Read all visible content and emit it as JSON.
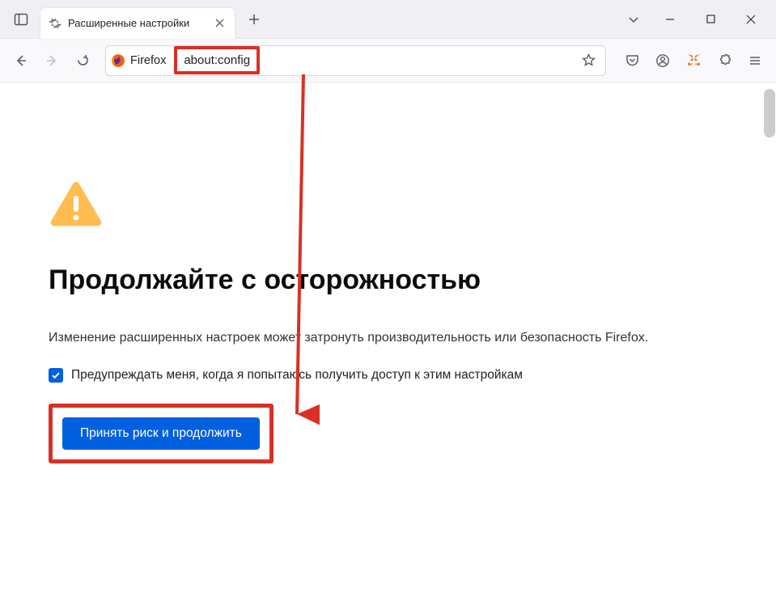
{
  "tab": {
    "title": "Расширенные настройки"
  },
  "urlbar": {
    "ff_label": "Firefox",
    "url": "about:config"
  },
  "page": {
    "heading": "Продолжайте с осторожностью",
    "body": "Изменение расширенных настроек может затронуть производительность или безопасность Firefox.",
    "checkbox_label": "Предупреждать меня, когда я попытаюсь получить доступ к этим настройкам",
    "accept_button": "Принять риск и продолжить"
  }
}
